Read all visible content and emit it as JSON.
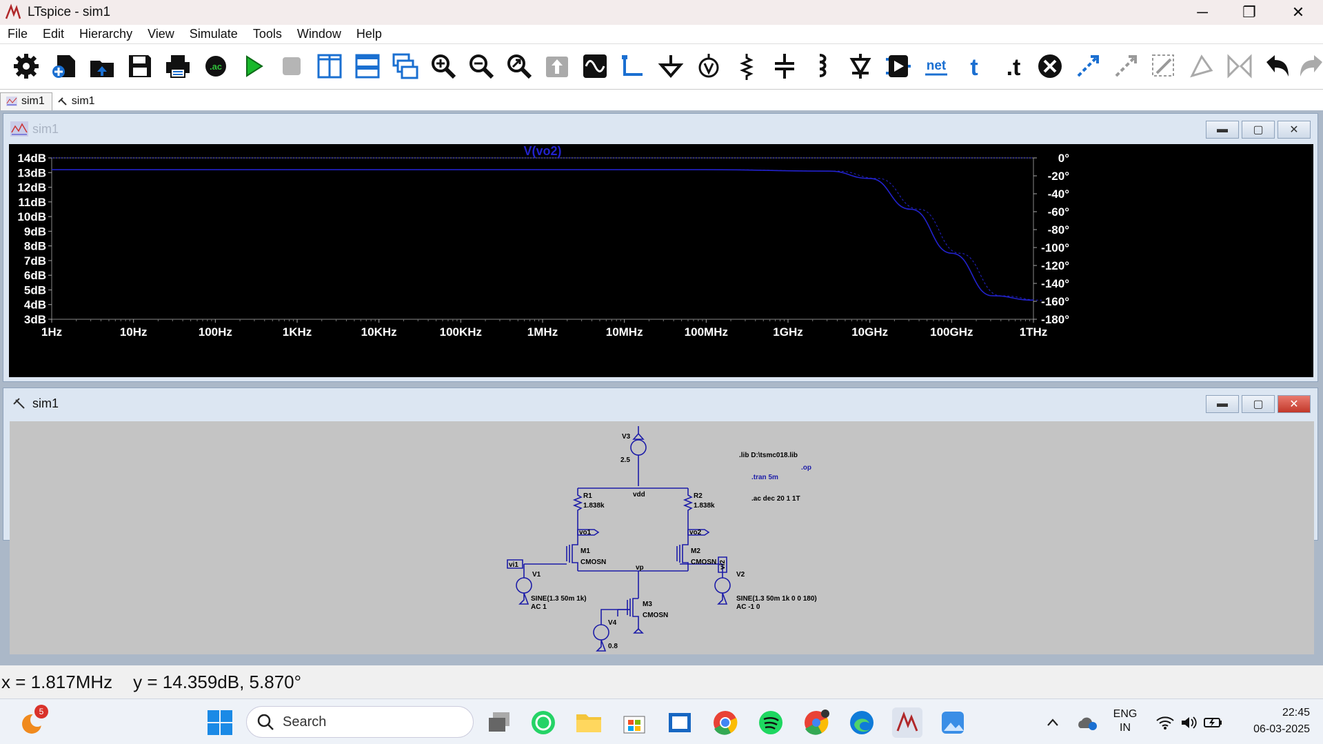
{
  "window": {
    "title": "LTspice - sim1"
  },
  "menu": [
    "File",
    "Edit",
    "Hierarchy",
    "View",
    "Simulate",
    "Tools",
    "Window",
    "Help"
  ],
  "toolbar_icons": [
    "settings-icon",
    "new-schematic-icon",
    "open-icon",
    "save-icon",
    "print-icon",
    "ac-analysis-icon",
    "run-icon",
    "halt-icon",
    "tile-vertical-icon",
    "tile-horizontal-icon",
    "cascade-icon",
    "zoom-in-icon",
    "zoom-out-icon",
    "zoom-fit-icon",
    "pan-icon",
    "autorange-icon",
    "wire-icon",
    "ground-icon",
    "label-net-icon",
    "resistor-icon",
    "capacitor-icon",
    "inductor-icon",
    "diode-icon",
    "component-icon",
    "net-text-icon",
    "text-icon",
    "spice-directive-icon",
    "delete-icon",
    "duplicate-icon",
    "move-icon",
    "drag-icon",
    "rotate-icon",
    "mirror-icon",
    "undo-icon",
    "redo-icon"
  ],
  "tabs": [
    {
      "label": "sim1",
      "icon": "waveform-tab-icon"
    },
    {
      "label": "sim1",
      "icon": "schematic-tab-icon"
    }
  ],
  "plot_window": {
    "title": "sim1",
    "trace_label": "V(vo2)",
    "trace_color": "#2222cc"
  },
  "chart_data": {
    "type": "line",
    "title": "V(vo2)",
    "x_scale": "log",
    "x_ticks": [
      "1Hz",
      "10Hz",
      "100Hz",
      "1KHz",
      "10KHz",
      "100KHz",
      "1MHz",
      "10MHz",
      "100MHz",
      "1GHz",
      "10GHz",
      "100GHz",
      "1THz"
    ],
    "x_tick_exponents": [
      0,
      1,
      2,
      3,
      4,
      5,
      6,
      7,
      8,
      9,
      10,
      11,
      12
    ],
    "ylim_left": [
      3,
      14
    ],
    "y_ticks_left": [
      "14dB",
      "13dB",
      "12dB",
      "11dB",
      "10dB",
      "9dB",
      "8dB",
      "7dB",
      "6dB",
      "5dB",
      "4dB",
      "3dB"
    ],
    "ylim_right": [
      -180,
      0
    ],
    "y_ticks_right": [
      "0°",
      "-20°",
      "-40°",
      "-60°",
      "-80°",
      "-100°",
      "-120°",
      "-140°",
      "-160°",
      "-180°"
    ],
    "series": [
      {
        "name": "V(vo2)",
        "axis": "left",
        "x_exp": [
          0,
          6,
          8,
          9.5,
          10,
          10.5,
          11,
          11.5,
          12
        ],
        "values": [
          13.2,
          13.2,
          13.2,
          13.1,
          12.6,
          10.5,
          7.5,
          4.6,
          4.3
        ]
      }
    ]
  },
  "schematic_window": {
    "title": "sim1",
    "labels": {
      "v3": "V3",
      "v3_val": "2.5",
      "vdd": "vdd",
      "r1": "R1",
      "r1_val": "1.838k",
      "r2": "R2",
      "r2_val": "1.838k",
      "vo1": "vo1",
      "vo2": "vo2",
      "vi1": "vi1",
      "vi2": "vi2",
      "m1": "M1",
      "m1_model": "CMOSN",
      "m2": "M2",
      "m2_model": "CMOSN",
      "m3": "M3",
      "m3_model": "CMOSN",
      "vp": "vp",
      "v1": "V1",
      "v1_val": "SINE(1.3 50m 1k)",
      "v1_ac": "AC 1",
      "v2": "V2",
      "v2_val": "SINE(1.3 50m 1k 0 0 180)",
      "v2_ac": "AC -1 0",
      "v4": "V4",
      "v4_val": "0.8",
      "lib": ".lib D:\\tsmc018.lib",
      "op": ".op",
      "tran": ".tran 5m",
      "ac": ".ac dec 20 1 1T"
    }
  },
  "status": {
    "x": "x = 1.817MHz",
    "y": "y = 14.359dB, 5.870°"
  },
  "taskbar": {
    "notification_count": "5",
    "search_placeholder": "Search",
    "lang": "ENG",
    "region": "IN",
    "time": "22:45",
    "date": "06-03-2025"
  }
}
